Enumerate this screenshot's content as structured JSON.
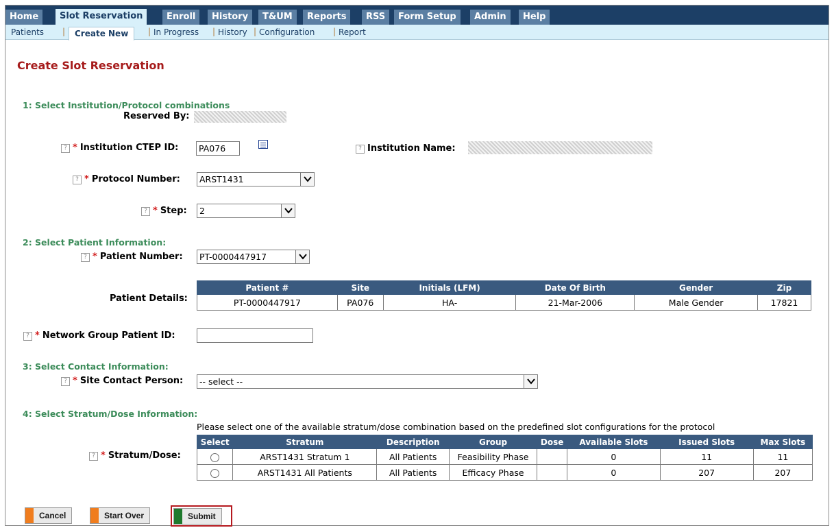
{
  "nav": {
    "tabs": [
      "Home",
      "Slot Reservation",
      "Enroll",
      "History",
      "T&UM",
      "Reports",
      "RSS",
      "Form Setup",
      "Admin",
      "Help"
    ],
    "active_tab": "Slot Reservation"
  },
  "subnav": {
    "items": [
      "Patients",
      "Create New",
      "In Progress",
      "History",
      "Configuration",
      "Report"
    ],
    "active": "Create New"
  },
  "page_title": "Create Slot Reservation",
  "sections": {
    "s1": "1: Select Institution/Protocol combinations",
    "s2": "2: Select Patient Information:",
    "s3": "3: Select Contact Information:",
    "s4": "4: Select Stratum/Dose Information:"
  },
  "form": {
    "reserved_by_label": "Reserved By:",
    "ctep_label": "Institution CTEP ID:",
    "ctep_value": "PA076",
    "inst_name_label": "Institution Name:",
    "protocol_label": "Protocol Number:",
    "protocol_value": "ARST1431",
    "step_label": "Step:",
    "step_value": "2",
    "patient_number_label": "Patient Number:",
    "patient_number_value": "PT-0000447917",
    "patient_details_label": "Patient Details:",
    "network_id_label": "Network Group Patient ID:",
    "network_id_value": "",
    "contact_label": "Site Contact Person:",
    "contact_value": "-- select --",
    "stratum_label": "Stratum/Dose:",
    "stratum_note": "Please select one of the available stratum/dose combination based on the predefined slot configurations for the protocol",
    "required_mark": "*",
    "help_mark": "?"
  },
  "patient_table": {
    "headers": [
      "Patient #",
      "Site",
      "Initials (LFM)",
      "Date Of Birth",
      "Gender",
      "Zip"
    ],
    "rows": [
      [
        "PT-0000447917",
        "PA076",
        "HA-",
        "21-Mar-2006",
        "Male Gender",
        "17821"
      ]
    ]
  },
  "stratum_table": {
    "headers": [
      "Select",
      "Stratum",
      "Description",
      "Group",
      "Dose",
      "Available Slots",
      "Issued Slots",
      "Max Slots"
    ],
    "rows": [
      [
        "",
        "ARST1431 Stratum 1",
        "All Patients",
        "Feasibility Phase",
        "",
        "0",
        "11",
        "11"
      ],
      [
        "",
        "ARST1431 All Patients",
        "All Patients",
        "Efficacy Phase",
        "",
        "0",
        "207",
        "207"
      ]
    ]
  },
  "buttons": {
    "cancel": "Cancel",
    "start_over": "Start Over",
    "submit": "Submit"
  },
  "colors": {
    "nav_bg": "#1c3f66",
    "title_red": "#a61b1b",
    "section_green": "#3c8c5a",
    "button_orange": "#f07d1e",
    "button_green": "#1f7a2e",
    "highlight_red": "#b5191f"
  }
}
